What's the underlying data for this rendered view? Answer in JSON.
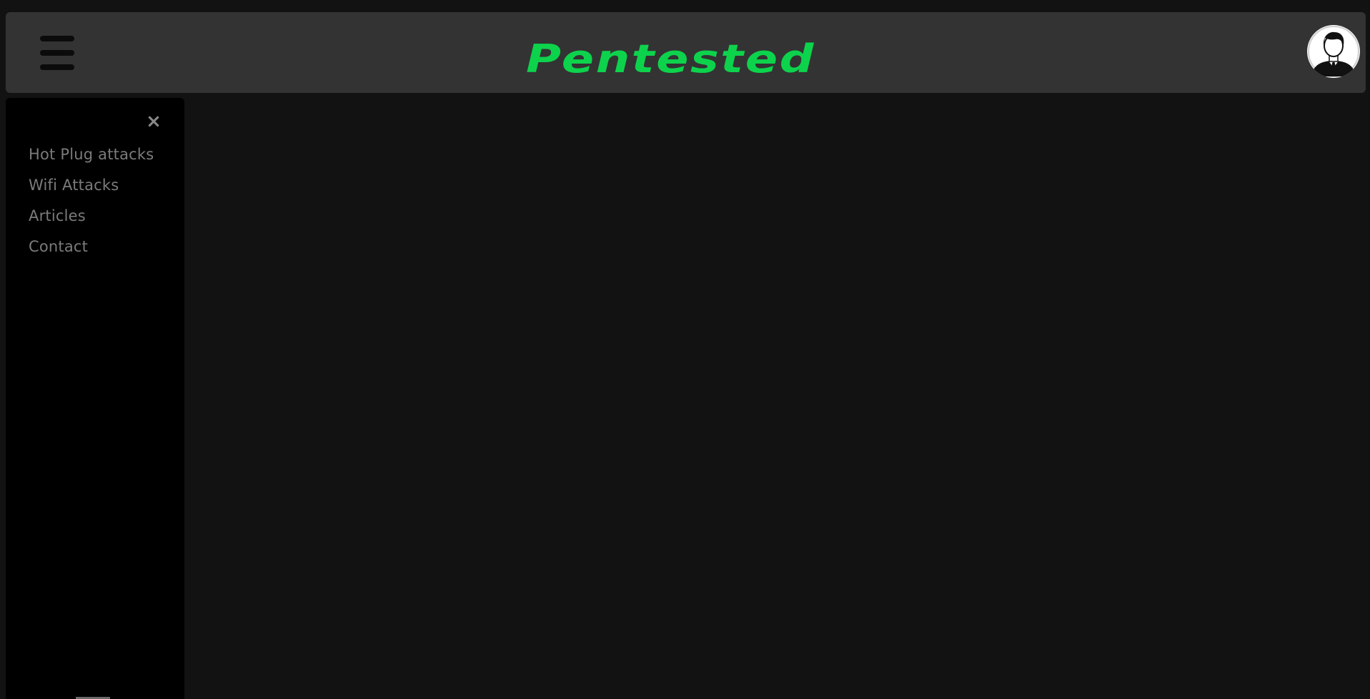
{
  "header": {
    "brand": "Pentested",
    "brand_color": "#0dd34c",
    "menu_icon": "hamburger-menu-icon",
    "profile_icon": "user-avatar-icon"
  },
  "sidebar": {
    "close_label": "×",
    "items": [
      {
        "label": "Hot Plug attacks"
      },
      {
        "label": "Wifi Attacks"
      },
      {
        "label": "Articles"
      },
      {
        "label": "Contact"
      }
    ]
  },
  "colors": {
    "background": "#121212",
    "topbar": "#333333",
    "sidebar": "#000000",
    "sidebar_text": "#7b7b7b"
  }
}
